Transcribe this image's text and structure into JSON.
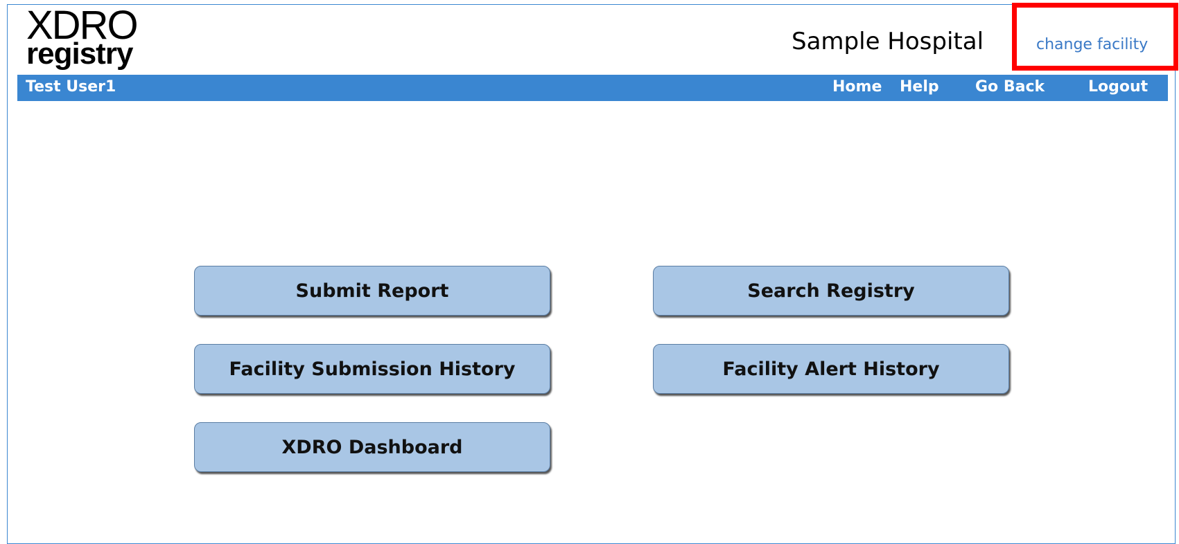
{
  "logo": {
    "line1": "XDRO",
    "line2": "registry"
  },
  "header": {
    "facility_name": "Sample Hospital",
    "change_facility_label": "change facility"
  },
  "navbar": {
    "user_name": "Test User1",
    "links": {
      "home": "Home",
      "help": "Help",
      "go_back": "Go Back",
      "logout": "Logout"
    }
  },
  "menu": {
    "submit_report": "Submit Report",
    "search_registry": "Search Registry",
    "facility_submission_history": "Facility Submission History",
    "facility_alert_history": "Facility Alert History",
    "xdro_dashboard": "XDRO Dashboard"
  },
  "colors": {
    "navbar_bg": "#3a86d1",
    "button_bg": "#a9c6e5",
    "link": "#3a79c6",
    "highlight": "#ff0000"
  }
}
